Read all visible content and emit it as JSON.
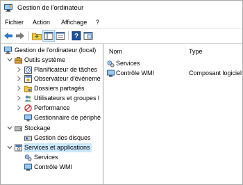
{
  "window": {
    "title": "Gestion de l'ordinateur"
  },
  "menu": {
    "items": [
      "Fichier",
      "Action",
      "Affichage",
      "?"
    ]
  },
  "toolbar": {
    "buttons": [
      "back-arrow-icon",
      "forward-arrow-icon",
      "up-folder-icon",
      "show-hide-tree-icon",
      "help-icon",
      "properties-icon"
    ]
  },
  "tree": {
    "root": "Gestion de l'ordinateur (local)",
    "system_tools": "Outils système",
    "task_scheduler": "Planificateur de tâches",
    "event_viewer": "Observateur d'événeme",
    "shared_folders": "Dossiers partagés",
    "local_users": "Utilisateurs et groupes l",
    "performance": "Performance",
    "device_manager": "Gestionnaire de périphé",
    "storage": "Stockage",
    "disk_management": "Gestion des disques",
    "services_apps": "Services et applications",
    "services": "Services",
    "wmi_control": "Contrôle WMI"
  },
  "list": {
    "columns": {
      "name": "Nom",
      "type": "Type"
    },
    "rows": [
      {
        "name": "Services",
        "type": ""
      },
      {
        "name": "Contrôle WMI",
        "type": "Composant logiciel"
      }
    ]
  },
  "colors": {
    "selection": "#cce8ff",
    "accent": "#1e6fc5"
  }
}
